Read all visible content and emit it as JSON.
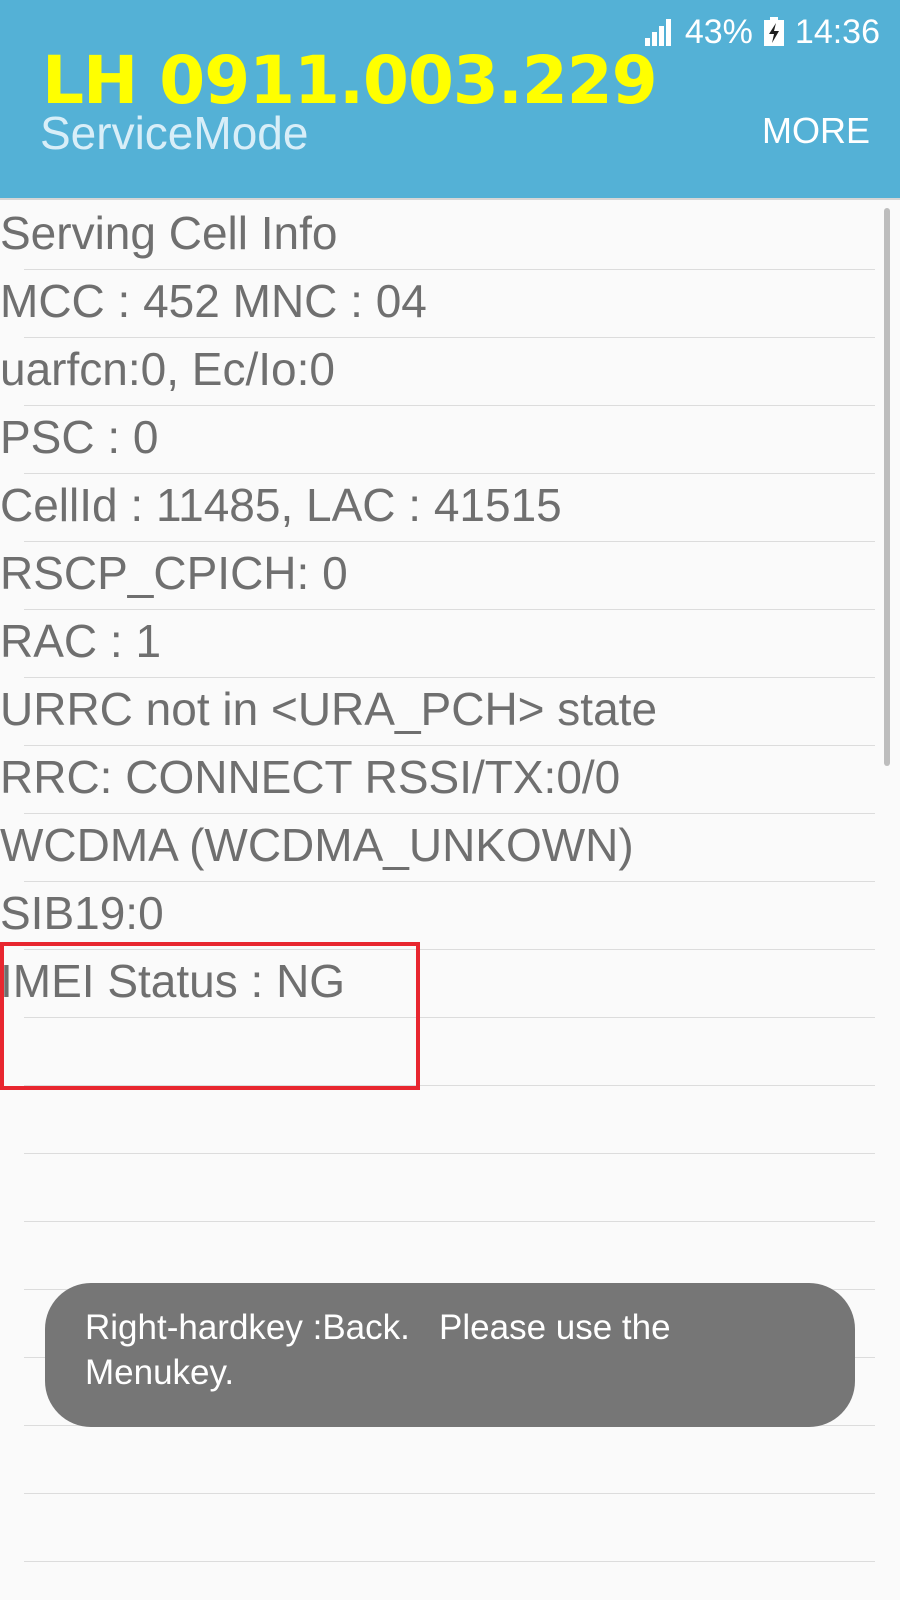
{
  "status": {
    "signal_icon": "cellular-signal-icon",
    "battery_percent": "43%",
    "battery_icon": "battery-charging-icon",
    "time": "14:36"
  },
  "header": {
    "watermark": "LH 0911.003.229",
    "title": "ServiceMode",
    "more_label": "MORE",
    "background_color": "#54b1d6",
    "watermark_color": "#ffff00"
  },
  "rows": [
    "Serving Cell Info",
    "MCC : 452 MNC : 04",
    "uarfcn:0, Ec/Io:0",
    "PSC : 0",
    "CellId : 11485, LAC : 41515",
    "RSCP_CPICH: 0",
    "RAC : 1",
    "URRC not in <URA_PCH> state",
    "RRC: CONNECT RSSI/TX:0/0",
    "WCDMA (WCDMA_UNKOWN)",
    "SIB19:0",
    "IMEI Status : NG",
    "",
    "",
    "",
    "",
    "",
    "",
    "",
    ""
  ],
  "highlight_color": "#e8262f",
  "toast": {
    "text": "Right-hardkey :Back.   Please use the Menukey."
  }
}
